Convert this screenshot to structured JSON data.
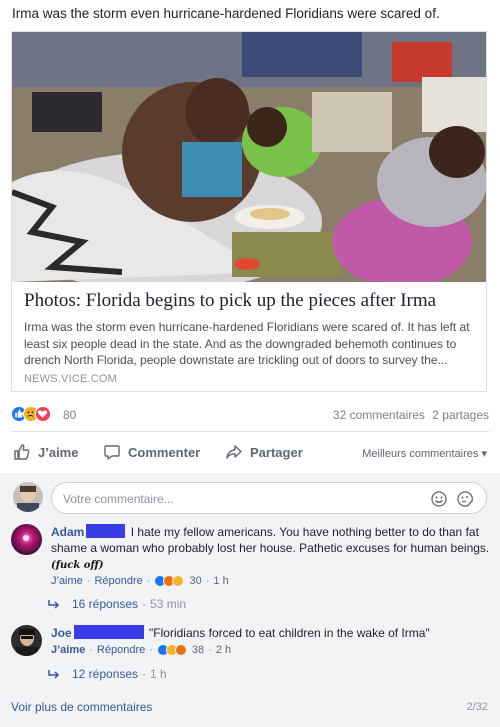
{
  "post": {
    "text": "Irma was the storm even hurricane-hardened Floridians were scared of."
  },
  "link": {
    "title": "Photos: Florida begins to pick up the pieces after Irma",
    "description": "Irma was the storm even hurricane-hardened Floridians were scared of. It has left at least six people dead in the state. And as the downgraded behemoth continues to drench North Florida, people downstate are trickling out of doors to survey the...",
    "domain": "NEWS.VICE.COM"
  },
  "reactions": {
    "icons": [
      "like",
      "sad",
      "love"
    ],
    "count": "80",
    "comments": "32 commentaires",
    "shares": "2 partages"
  },
  "actions": {
    "like": "J’aime",
    "comment": "Commenter",
    "share": "Partager",
    "sort": "Meilleurs commentaires ▾"
  },
  "composer": {
    "placeholder": "Votre commentaire..."
  },
  "comments": [
    {
      "name": "Adam",
      "text": "I hate my fellow americans. You have nothing better to do than fat shame a woman who probably lost her house. Pathetic excuses for human beings.",
      "handwritten": "(fuck off)",
      "like": "J’aime",
      "reply": "Répondre",
      "reaction_icons": [
        "like",
        "angry",
        "haha"
      ],
      "reaction_count": "30",
      "time": "1 h",
      "replies": "16 réponses",
      "replies_time": "53 min"
    },
    {
      "name": "Joe",
      "text": "\"Floridians forced to eat children in the wake of Irma\"",
      "like": "J’aime",
      "reply": "Répondre",
      "reaction_icons": [
        "like",
        "haha",
        "angry"
      ],
      "reaction_count": "38",
      "time": "2 h",
      "replies": "12 réponses",
      "replies_time": "1 h"
    }
  ],
  "footer": {
    "see_more": "Voir plus de commentaires",
    "pager": "2/32"
  },
  "colors": {
    "link_blue": "#385898",
    "like_blue": "#1877f2",
    "love_red": "#f33e58",
    "sad_yellow": "#f7b125",
    "angry_orange": "#e9710f",
    "redaction": "#3a3de6"
  }
}
